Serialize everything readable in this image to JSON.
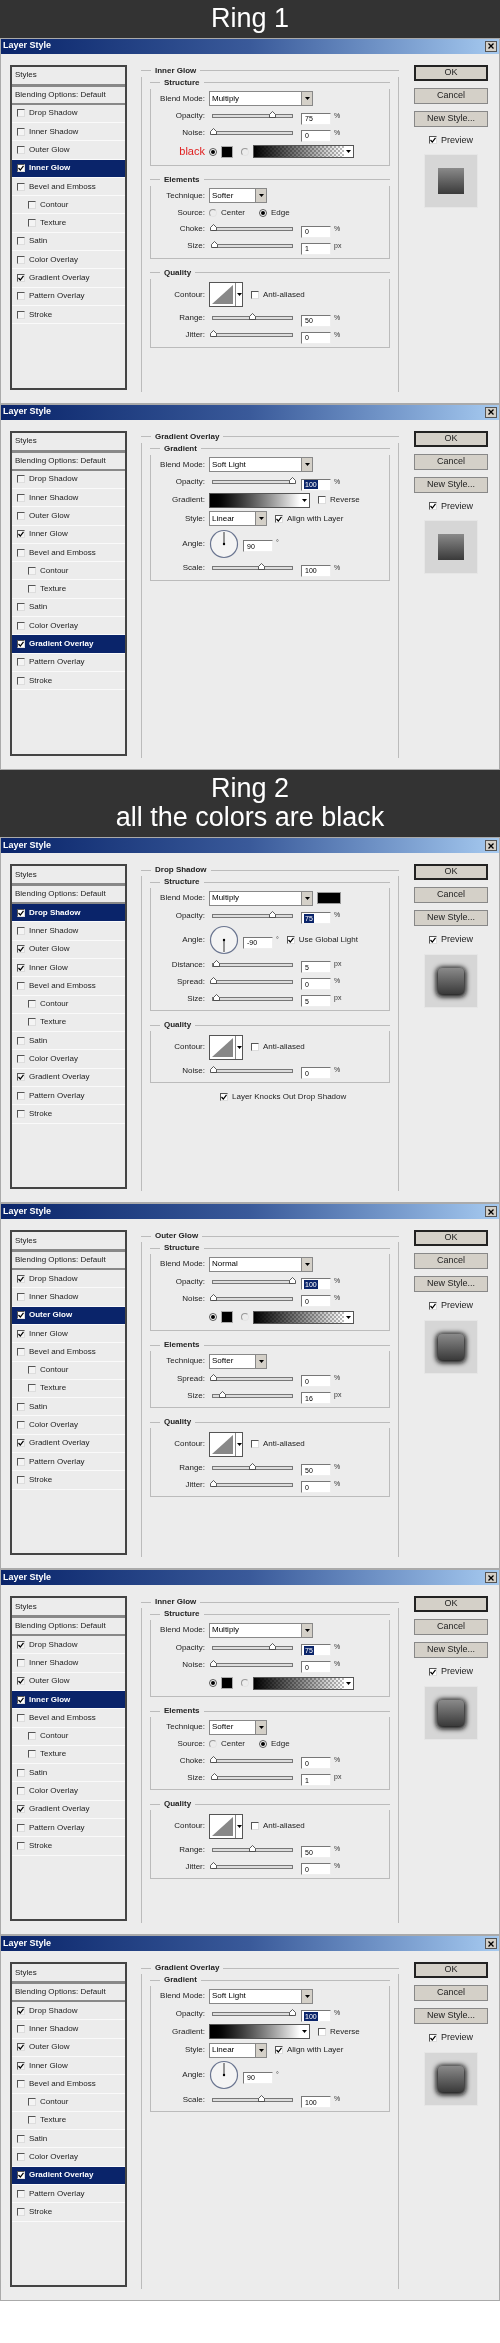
{
  "sections": [
    {
      "kind": "header",
      "lines": [
        "Ring 1"
      ]
    },
    {
      "kind": "dialog",
      "title": "Layer Style",
      "styles_heading": "Styles",
      "blending": "Blending Options: Default",
      "styles": [
        {
          "label": "Drop Shadow",
          "checked": false,
          "selected": false
        },
        {
          "label": "Inner Shadow",
          "checked": false,
          "selected": false
        },
        {
          "label": "Outer Glow",
          "checked": false,
          "selected": false
        },
        {
          "label": "Inner Glow",
          "checked": true,
          "selected": true
        },
        {
          "label": "Bevel and Emboss",
          "checked": false,
          "selected": false,
          "children": [
            {
              "label": "Contour",
              "checked": false,
              "selected": false
            },
            {
              "label": "Texture",
              "checked": false,
              "selected": false
            }
          ]
        },
        {
          "label": "Satin",
          "checked": false,
          "selected": false
        },
        {
          "label": "Color Overlay",
          "checked": false,
          "selected": false
        },
        {
          "label": "Gradient Overlay",
          "checked": true,
          "selected": false
        },
        {
          "label": "Pattern Overlay",
          "checked": false,
          "selected": false
        },
        {
          "label": "Stroke",
          "checked": false,
          "selected": false
        }
      ],
      "panel": {
        "title": "Inner Glow",
        "groups": [
          {
            "title": "Structure",
            "rows": [
              {
                "kind": "dropdown",
                "label": "Blend Mode:",
                "value": "Multiply"
              },
              {
                "kind": "slider",
                "label": "Opacity:",
                "level": 0.75,
                "value": "75",
                "unit": "%",
                "highlighted": false
              },
              {
                "kind": "slider",
                "label": "Noise:",
                "level": 0,
                "value": "0",
                "unit": "%",
                "highlighted": false
              },
              {
                "kind": "color",
                "annotation": "black",
                "options": [
                  {
                    "kind": "solid",
                    "selected": true
                  },
                  {
                    "kind": "gradient",
                    "selected": false
                  }
                ]
              }
            ]
          },
          {
            "title": "Elements",
            "rows": [
              {
                "kind": "small-dropdown",
                "label": "Technique:",
                "value": "Softer"
              },
              {
                "kind": "radio",
                "label": "Source:",
                "options": [
                  {
                    "label": "Center",
                    "selected": false
                  },
                  {
                    "label": "Edge",
                    "selected": true
                  }
                ]
              },
              {
                "kind": "slider",
                "label": "Choke:",
                "level": 0,
                "value": "0",
                "unit": "%",
                "highlighted": false
              },
              {
                "kind": "slider",
                "label": "Size:",
                "level": 0.02,
                "value": "1",
                "unit": "px",
                "highlighted": false
              }
            ]
          },
          {
            "title": "Quality",
            "rows": [
              {
                "kind": "contour",
                "label": "Contour:",
                "checkbox": {
                  "label": "Anti-aliased",
                  "checked": false
                }
              },
              {
                "kind": "slider",
                "label": "Range:",
                "level": 0.5,
                "value": "50",
                "unit": "%",
                "highlighted": false
              },
              {
                "kind": "slider",
                "label": "Jitter:",
                "level": 0,
                "value": "0",
                "unit": "%",
                "highlighted": false
              }
            ]
          }
        ]
      },
      "buttons": [
        {
          "label": "OK",
          "default": true
        },
        {
          "label": "Cancel",
          "default": false
        },
        {
          "label": "New Style...",
          "default": false
        }
      ],
      "preview": {
        "label": "Preview",
        "checked": true,
        "glow": false
      }
    },
    {
      "kind": "dialog",
      "title": "Layer Style",
      "styles_heading": "Styles",
      "blending": "Blending Options: Default",
      "styles": [
        {
          "label": "Drop Shadow",
          "checked": false,
          "selected": false
        },
        {
          "label": "Inner Shadow",
          "checked": false,
          "selected": false
        },
        {
          "label": "Outer Glow",
          "checked": false,
          "selected": false
        },
        {
          "label": "Inner Glow",
          "checked": true,
          "selected": false
        },
        {
          "label": "Bevel and Emboss",
          "checked": false,
          "selected": false,
          "children": [
            {
              "label": "Contour",
              "checked": false,
              "selected": false
            },
            {
              "label": "Texture",
              "checked": false,
              "selected": false
            }
          ]
        },
        {
          "label": "Satin",
          "checked": false,
          "selected": false
        },
        {
          "label": "Color Overlay",
          "checked": false,
          "selected": false
        },
        {
          "label": "Gradient Overlay",
          "checked": true,
          "selected": true
        },
        {
          "label": "Pattern Overlay",
          "checked": false,
          "selected": false
        },
        {
          "label": "Stroke",
          "checked": false,
          "selected": false
        }
      ],
      "panel": {
        "title": "Gradient Overlay",
        "groups": [
          {
            "title": "Gradient",
            "rows": [
              {
                "kind": "dropdown",
                "label": "Blend Mode:",
                "value": "Soft Light"
              },
              {
                "kind": "slider",
                "label": "Opacity:",
                "level": 1,
                "value": "100",
                "unit": "%",
                "highlighted": true
              },
              {
                "kind": "gradient",
                "label": "Gradient:",
                "checkbox": {
                  "label": "Reverse",
                  "checked": false
                }
              },
              {
                "kind": "small-dropdown",
                "label": "Style:",
                "value": "Linear",
                "checkbox": {
                  "label": "Align with Layer",
                  "checked": true
                }
              },
              {
                "kind": "angle",
                "label": "Angle:",
                "value": "90",
                "unit": "°"
              },
              {
                "kind": "slider",
                "label": "Scale:",
                "level": 0.62,
                "value": "100",
                "unit": "%",
                "highlighted": false
              }
            ]
          }
        ]
      },
      "buttons": [
        {
          "label": "OK",
          "default": true
        },
        {
          "label": "Cancel",
          "default": false
        },
        {
          "label": "New Style...",
          "default": false
        }
      ],
      "preview": {
        "label": "Preview",
        "checked": true,
        "glow": false
      }
    },
    {
      "kind": "header",
      "lines": [
        "Ring 2",
        "all the colors are black"
      ]
    },
    {
      "kind": "dialog",
      "title": "Layer Style",
      "styles_heading": "Styles",
      "blending": "Blending Options: Default",
      "styles": [
        {
          "label": "Drop Shadow",
          "checked": true,
          "selected": true
        },
        {
          "label": "Inner Shadow",
          "checked": false,
          "selected": false
        },
        {
          "label": "Outer Glow",
          "checked": true,
          "selected": false
        },
        {
          "label": "Inner Glow",
          "checked": true,
          "selected": false
        },
        {
          "label": "Bevel and Emboss",
          "checked": false,
          "selected": false,
          "children": [
            {
              "label": "Contour",
              "checked": false,
              "selected": false
            },
            {
              "label": "Texture",
              "checked": false,
              "selected": false
            }
          ]
        },
        {
          "label": "Satin",
          "checked": false,
          "selected": false
        },
        {
          "label": "Color Overlay",
          "checked": false,
          "selected": false
        },
        {
          "label": "Gradient Overlay",
          "checked": true,
          "selected": false
        },
        {
          "label": "Pattern Overlay",
          "checked": false,
          "selected": false
        },
        {
          "label": "Stroke",
          "checked": false,
          "selected": false
        }
      ],
      "panel": {
        "title": "Drop Shadow",
        "groups": [
          {
            "title": "Structure",
            "rows": [
              {
                "kind": "dropdown",
                "label": "Blend Mode:",
                "value": "Multiply",
                "swatch": true
              },
              {
                "kind": "slider",
                "label": "Opacity:",
                "level": 0.75,
                "value": "75",
                "unit": "%",
                "highlighted": true
              },
              {
                "kind": "angle",
                "label": "Angle:",
                "value": "-90",
                "unit": "°",
                "checkbox": {
                  "label": "Use Global Light",
                  "checked": true
                }
              },
              {
                "kind": "slider",
                "label": "Distance:",
                "level": 0.05,
                "value": "5",
                "unit": "px",
                "highlighted": false
              },
              {
                "kind": "slider",
                "label": "Spread:",
                "level": 0,
                "value": "0",
                "unit": "%",
                "highlighted": false
              },
              {
                "kind": "slider",
                "label": "Size:",
                "level": 0.05,
                "value": "5",
                "unit": "px",
                "highlighted": false
              }
            ]
          },
          {
            "title": "Quality",
            "rows": [
              {
                "kind": "contour",
                "label": "Contour:",
                "checkbox": {
                  "label": "Anti-aliased",
                  "checked": false
                }
              },
              {
                "kind": "slider",
                "label": "Noise:",
                "level": 0,
                "value": "0",
                "unit": "%",
                "highlighted": false
              }
            ]
          }
        ],
        "footer": {
          "label": "Layer Knocks Out Drop Shadow",
          "checked": true
        }
      },
      "buttons": [
        {
          "label": "OK",
          "default": true
        },
        {
          "label": "Cancel",
          "default": false
        },
        {
          "label": "New Style...",
          "default": false
        }
      ],
      "preview": {
        "label": "Preview",
        "checked": true,
        "glow": true
      }
    },
    {
      "kind": "dialog",
      "title": "Layer Style",
      "styles_heading": "Styles",
      "blending": "Blending Options: Default",
      "styles": [
        {
          "label": "Drop Shadow",
          "checked": true,
          "selected": false
        },
        {
          "label": "Inner Shadow",
          "checked": false,
          "selected": false
        },
        {
          "label": "Outer Glow",
          "checked": true,
          "selected": true
        },
        {
          "label": "Inner Glow",
          "checked": true,
          "selected": false
        },
        {
          "label": "Bevel and Emboss",
          "checked": false,
          "selected": false,
          "children": [
            {
              "label": "Contour",
              "checked": false,
              "selected": false
            },
            {
              "label": "Texture",
              "checked": false,
              "selected": false
            }
          ]
        },
        {
          "label": "Satin",
          "checked": false,
          "selected": false
        },
        {
          "label": "Color Overlay",
          "checked": false,
          "selected": false
        },
        {
          "label": "Gradient Overlay",
          "checked": true,
          "selected": false
        },
        {
          "label": "Pattern Overlay",
          "checked": false,
          "selected": false
        },
        {
          "label": "Stroke",
          "checked": false,
          "selected": false
        }
      ],
      "panel": {
        "title": "Outer Glow",
        "groups": [
          {
            "title": "Structure",
            "rows": [
              {
                "kind": "dropdown",
                "label": "Blend Mode:",
                "value": "Normal"
              },
              {
                "kind": "slider",
                "label": "Opacity:",
                "level": 1,
                "value": "100",
                "unit": "%",
                "highlighted": true
              },
              {
                "kind": "slider",
                "label": "Noise:",
                "level": 0,
                "value": "0",
                "unit": "%",
                "highlighted": false
              },
              {
                "kind": "color",
                "options": [
                  {
                    "kind": "solid",
                    "selected": true
                  },
                  {
                    "kind": "gradient",
                    "selected": false
                  }
                ]
              }
            ]
          },
          {
            "title": "Elements",
            "rows": [
              {
                "kind": "small-dropdown",
                "label": "Technique:",
                "value": "Softer"
              },
              {
                "kind": "slider",
                "label": "Spread:",
                "level": 0,
                "value": "0",
                "unit": "%",
                "highlighted": false
              },
              {
                "kind": "slider",
                "label": "Size:",
                "level": 0.12,
                "value": "16",
                "unit": "px",
                "highlighted": false
              }
            ]
          },
          {
            "title": "Quality",
            "rows": [
              {
                "kind": "contour",
                "label": "Contour:",
                "checkbox": {
                  "label": "Anti-aliased",
                  "checked": false
                }
              },
              {
                "kind": "slider",
                "label": "Range:",
                "level": 0.5,
                "value": "50",
                "unit": "%",
                "highlighted": false
              },
              {
                "kind": "slider",
                "label": "Jitter:",
                "level": 0,
                "value": "0",
                "unit": "%",
                "highlighted": false
              }
            ]
          }
        ]
      },
      "buttons": [
        {
          "label": "OK",
          "default": true
        },
        {
          "label": "Cancel",
          "default": false
        },
        {
          "label": "New Style...",
          "default": false
        }
      ],
      "preview": {
        "label": "Preview",
        "checked": true,
        "glow": true
      }
    },
    {
      "kind": "dialog",
      "title": "Layer Style",
      "styles_heading": "Styles",
      "blending": "Blending Options: Default",
      "styles": [
        {
          "label": "Drop Shadow",
          "checked": true,
          "selected": false
        },
        {
          "label": "Inner Shadow",
          "checked": false,
          "selected": false
        },
        {
          "label": "Outer Glow",
          "checked": true,
          "selected": false
        },
        {
          "label": "Inner Glow",
          "checked": true,
          "selected": true
        },
        {
          "label": "Bevel and Emboss",
          "checked": false,
          "selected": false,
          "children": [
            {
              "label": "Contour",
              "checked": false,
              "selected": false
            },
            {
              "label": "Texture",
              "checked": false,
              "selected": false
            }
          ]
        },
        {
          "label": "Satin",
          "checked": false,
          "selected": false
        },
        {
          "label": "Color Overlay",
          "checked": false,
          "selected": false
        },
        {
          "label": "Gradient Overlay",
          "checked": true,
          "selected": false
        },
        {
          "label": "Pattern Overlay",
          "checked": false,
          "selected": false
        },
        {
          "label": "Stroke",
          "checked": false,
          "selected": false
        }
      ],
      "panel": {
        "title": "Inner Glow",
        "groups": [
          {
            "title": "Structure",
            "rows": [
              {
                "kind": "dropdown",
                "label": "Blend Mode:",
                "value": "Multiply"
              },
              {
                "kind": "slider",
                "label": "Opacity:",
                "level": 0.75,
                "value": "75",
                "unit": "%",
                "highlighted": true
              },
              {
                "kind": "slider",
                "label": "Noise:",
                "level": 0,
                "value": "0",
                "unit": "%",
                "highlighted": false
              },
              {
                "kind": "color",
                "options": [
                  {
                    "kind": "solid",
                    "selected": true
                  },
                  {
                    "kind": "gradient",
                    "selected": false
                  }
                ]
              }
            ]
          },
          {
            "title": "Elements",
            "rows": [
              {
                "kind": "small-dropdown",
                "label": "Technique:",
                "value": "Softer"
              },
              {
                "kind": "radio",
                "label": "Source:",
                "options": [
                  {
                    "label": "Center",
                    "selected": false
                  },
                  {
                    "label": "Edge",
                    "selected": true
                  }
                ]
              },
              {
                "kind": "slider",
                "label": "Choke:",
                "level": 0,
                "value": "0",
                "unit": "%",
                "highlighted": false
              },
              {
                "kind": "slider",
                "label": "Size:",
                "level": 0.02,
                "value": "1",
                "unit": "px",
                "highlighted": false
              }
            ]
          },
          {
            "title": "Quality",
            "rows": [
              {
                "kind": "contour",
                "label": "Contour:",
                "checkbox": {
                  "label": "Anti-aliased",
                  "checked": false
                }
              },
              {
                "kind": "slider",
                "label": "Range:",
                "level": 0.5,
                "value": "50",
                "unit": "%",
                "highlighted": false
              },
              {
                "kind": "slider",
                "label": "Jitter:",
                "level": 0,
                "value": "0",
                "unit": "%",
                "highlighted": false
              }
            ]
          }
        ]
      },
      "buttons": [
        {
          "label": "OK",
          "default": true
        },
        {
          "label": "Cancel",
          "default": false
        },
        {
          "label": "New Style...",
          "default": false
        }
      ],
      "preview": {
        "label": "Preview",
        "checked": true,
        "glow": true
      }
    },
    {
      "kind": "dialog",
      "title": "Layer Style",
      "styles_heading": "Styles",
      "blending": "Blending Options: Default",
      "styles": [
        {
          "label": "Drop Shadow",
          "checked": true,
          "selected": false
        },
        {
          "label": "Inner Shadow",
          "checked": false,
          "selected": false
        },
        {
          "label": "Outer Glow",
          "checked": true,
          "selected": false
        },
        {
          "label": "Inner Glow",
          "checked": true,
          "selected": false
        },
        {
          "label": "Bevel and Emboss",
          "checked": false,
          "selected": false,
          "children": [
            {
              "label": "Contour",
              "checked": false,
              "selected": false
            },
            {
              "label": "Texture",
              "checked": false,
              "selected": false
            }
          ]
        },
        {
          "label": "Satin",
          "checked": false,
          "selected": false
        },
        {
          "label": "Color Overlay",
          "checked": false,
          "selected": false
        },
        {
          "label": "Gradient Overlay",
          "checked": true,
          "selected": true
        },
        {
          "label": "Pattern Overlay",
          "checked": false,
          "selected": false
        },
        {
          "label": "Stroke",
          "checked": false,
          "selected": false
        }
      ],
      "panel": {
        "title": "Gradient Overlay",
        "groups": [
          {
            "title": "Gradient",
            "rows": [
              {
                "kind": "dropdown",
                "label": "Blend Mode:",
                "value": "Soft Light"
              },
              {
                "kind": "slider",
                "label": "Opacity:",
                "level": 1,
                "value": "100",
                "unit": "%",
                "highlighted": true
              },
              {
                "kind": "gradient",
                "label": "Gradient:",
                "checkbox": {
                  "label": "Reverse",
                  "checked": false
                }
              },
              {
                "kind": "small-dropdown",
                "label": "Style:",
                "value": "Linear",
                "checkbox": {
                  "label": "Align with Layer",
                  "checked": true
                }
              },
              {
                "kind": "angle",
                "label": "Angle:",
                "value": "90",
                "unit": "°"
              },
              {
                "kind": "slider",
                "label": "Scale:",
                "level": 0.62,
                "value": "100",
                "unit": "%",
                "highlighted": false
              }
            ]
          }
        ]
      },
      "buttons": [
        {
          "label": "OK",
          "default": true
        },
        {
          "label": "Cancel",
          "default": false
        },
        {
          "label": "New Style...",
          "default": false
        }
      ],
      "preview": {
        "label": "Preview",
        "checked": true,
        "glow": true
      }
    }
  ]
}
